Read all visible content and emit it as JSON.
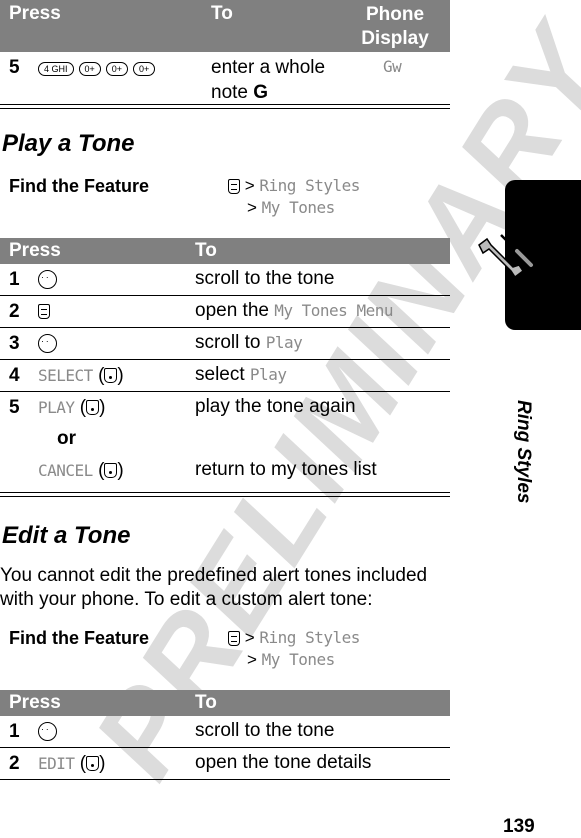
{
  "watermark": "PRELIMINARY",
  "top_table": {
    "headers": {
      "press": "Press",
      "to": "To",
      "display_line1": "Phone",
      "display_line2": "Display"
    },
    "row": {
      "num": "5",
      "keys": [
        "4 GHI",
        "0+",
        "0+",
        "0+"
      ],
      "to_line1": "enter a whole",
      "to_line2_prefix": "note ",
      "to_line2_bold": "G",
      "display": "Gw"
    }
  },
  "play_section": {
    "title": "Play a Tone",
    "find_label": "Find the Feature",
    "path": [
      {
        "sep": ">",
        "item": "Ring Styles"
      },
      {
        "sep": ">",
        "item": "My Tones"
      }
    ],
    "headers": {
      "press": "Press",
      "to": "To"
    },
    "rows": [
      {
        "num": "1",
        "press_icon": "nav-key-icon",
        "press_text": "",
        "to": "scroll to the tone",
        "to_mono": ""
      },
      {
        "num": "2",
        "press_icon": "menu-key-icon",
        "press_text": "",
        "to": "open the ",
        "to_mono": "My Tones Menu"
      },
      {
        "num": "3",
        "press_icon": "nav-key-icon",
        "press_text": "",
        "to": "scroll to ",
        "to_mono": "Play"
      },
      {
        "num": "4",
        "press_icon": "",
        "press_text": "SELECT",
        "to": "select ",
        "to_mono": "Play"
      },
      {
        "num": "5",
        "press_icon": "",
        "press_text": "PLAY",
        "to": "play the tone again",
        "to_mono": ""
      }
    ],
    "or_label": "or",
    "cancel_row": {
      "press_text": "CANCEL",
      "to": "return to my tones list"
    }
  },
  "edit_section": {
    "title": "Edit a Tone",
    "intro": "You cannot edit the predefined alert tones included with your phone. To edit a custom alert tone:",
    "find_label": "Find the Feature",
    "path": [
      {
        "sep": ">",
        "item": "Ring Styles"
      },
      {
        "sep": ">",
        "item": "My Tones"
      }
    ],
    "headers": {
      "press": "Press",
      "to": "To"
    },
    "rows": [
      {
        "num": "1",
        "press_text": "",
        "to": "scroll to the tone"
      },
      {
        "num": "2",
        "press_text": "EDIT",
        "to": "open the tone details"
      }
    ]
  },
  "side_tab": {
    "label": "Ring Styles",
    "icon": "tools-icon"
  },
  "page_number": "139"
}
